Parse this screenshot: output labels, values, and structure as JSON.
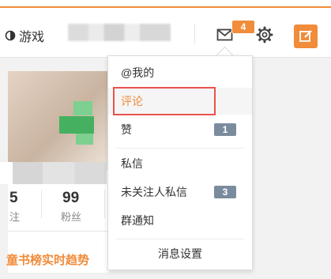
{
  "colors": {
    "accent": "#f08c3a",
    "badge_gray": "#7b8b9e",
    "highlight_frame": "#e8534d"
  },
  "topbar": {
    "game_label": "游戏",
    "icons": [
      "game-icon",
      "mail-icon",
      "gear-icon",
      "compose-icon"
    ],
    "mail_badge": "4"
  },
  "profile": {
    "stats": [
      {
        "value": "5",
        "label": "注"
      },
      {
        "value": "99",
        "label": "粉丝"
      }
    ],
    "trend_title": "童书榜实时趋势"
  },
  "dropdown": {
    "items": [
      {
        "label": "@我的"
      },
      {
        "label": "评论"
      },
      {
        "label": "赞",
        "count": "1"
      },
      {
        "label": "私信"
      },
      {
        "label": "未关注人私信",
        "count": "3"
      },
      {
        "label": "群通知"
      }
    ],
    "settings_label": "消息设置"
  }
}
